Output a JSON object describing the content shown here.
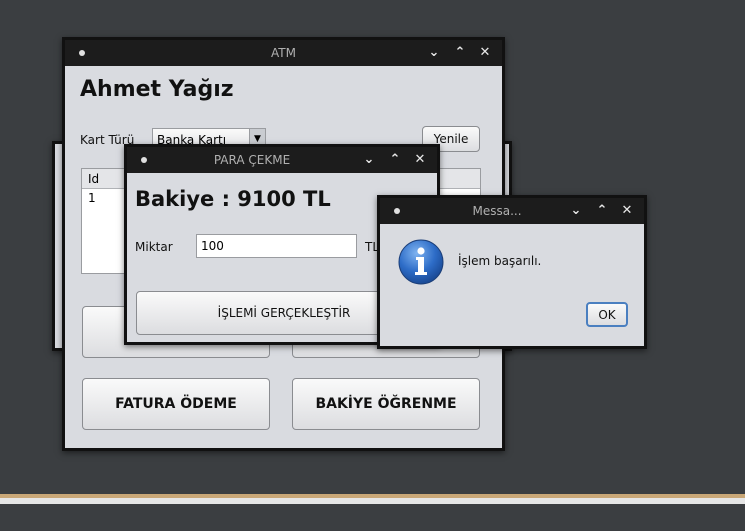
{
  "main_window": {
    "title": "ATM",
    "user_name": "Ahmet Yağız",
    "card_type_label": "Kart Türü",
    "card_type_value": "Banka Kartı",
    "refresh_button": "Yenile",
    "table": {
      "header": "Id",
      "rows": [
        "1"
      ]
    },
    "buttons": {
      "bill_payment": "FATURA ÖDEME",
      "balance_inquiry": "BAKİYE ÖĞRENME"
    }
  },
  "withdraw_window": {
    "title": "PARA ÇEKME",
    "balance": "Bakiye : 9100 TL",
    "amount_label": "Miktar",
    "amount_value": "100",
    "currency": "TL",
    "submit_button": "İŞLEMİ GERÇEKLEŞTİR"
  },
  "message_dialog": {
    "title": "Messa...",
    "message": "İşlem başarılı.",
    "ok_button": "OK",
    "icon": "info-icon"
  },
  "window_controls": {
    "minimize": "⌄",
    "maximize": "⌃",
    "close": "✕"
  }
}
